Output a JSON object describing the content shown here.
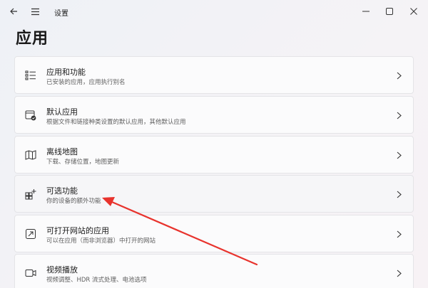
{
  "window": {
    "title": "设置"
  },
  "page": {
    "title": "应用"
  },
  "cards": [
    {
      "title": "应用和功能",
      "subtitle": "已安装的应用，应用执行别名",
      "icon": "apps-list-icon"
    },
    {
      "title": "默认应用",
      "subtitle": "根据文件和链接种类设置的默认应用，其他默认应用",
      "icon": "default-apps-icon"
    },
    {
      "title": "离线地图",
      "subtitle": "下载、存储位置，地图更新",
      "icon": "map-icon"
    },
    {
      "title": "可选功能",
      "subtitle": "你的设备的额外功能",
      "icon": "optional-features-icon"
    },
    {
      "title": "可打开网站的应用",
      "subtitle": "可以在应用（而非浏览器）中打开的网站",
      "icon": "open-website-icon"
    },
    {
      "title": "视频播放",
      "subtitle": "视频调整、HDR 流式处理、电池选项",
      "icon": "video-icon"
    }
  ],
  "colors": {
    "annotation_arrow": "#e8332d"
  }
}
